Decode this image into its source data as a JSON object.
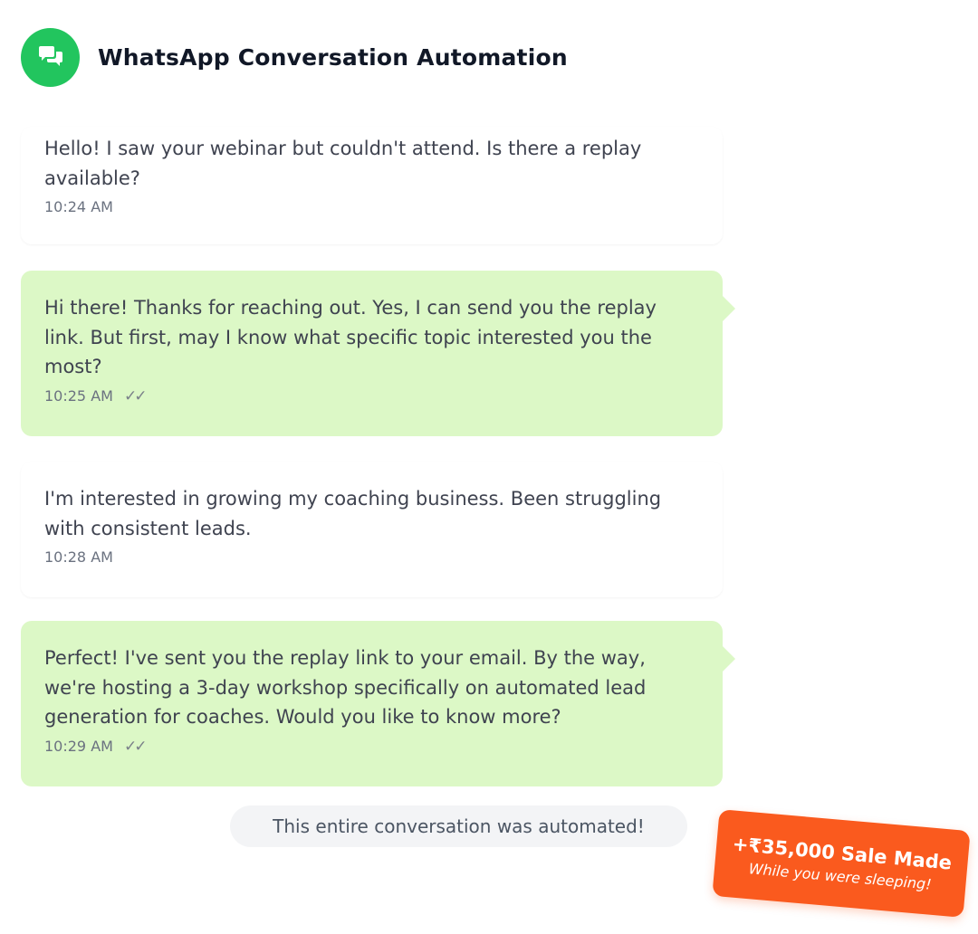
{
  "header": {
    "title": "WhatsApp Conversation Automation",
    "icon": "chat-icon",
    "icon_color": "#22c55e"
  },
  "messages": [
    {
      "direction": "incoming",
      "text": "Hello! I saw your webinar but couldn't attend. Is there a replay available?",
      "time": "10:24 AM"
    },
    {
      "direction": "outgoing",
      "text": "Hi there! Thanks for reaching out. Yes, I can send you the replay link. But first, may I know what specific topic interested you the most?",
      "time": "10:25 AM",
      "ticks": "✓✓"
    },
    {
      "direction": "incoming",
      "text": "I'm interested in growing my coaching business. Been struggling with consistent leads.",
      "time": "10:28 AM"
    },
    {
      "direction": "outgoing",
      "text": "Perfect! I've sent you the replay link to your email. By the way, we're hosting a 3-day workshop specifically on automated lead generation for coaches. Would you like to know more?",
      "time": "10:29 AM",
      "ticks": "✓✓"
    }
  ],
  "footer_note": "This entire conversation was automated!",
  "badge": {
    "title": "+₹35,000 Sale Made",
    "subtitle": "While you were sleeping!",
    "color": "#fa5a1e"
  },
  "colors": {
    "outgoing_bubble": "#dcf8c6",
    "incoming_bubble": "#ffffff"
  }
}
